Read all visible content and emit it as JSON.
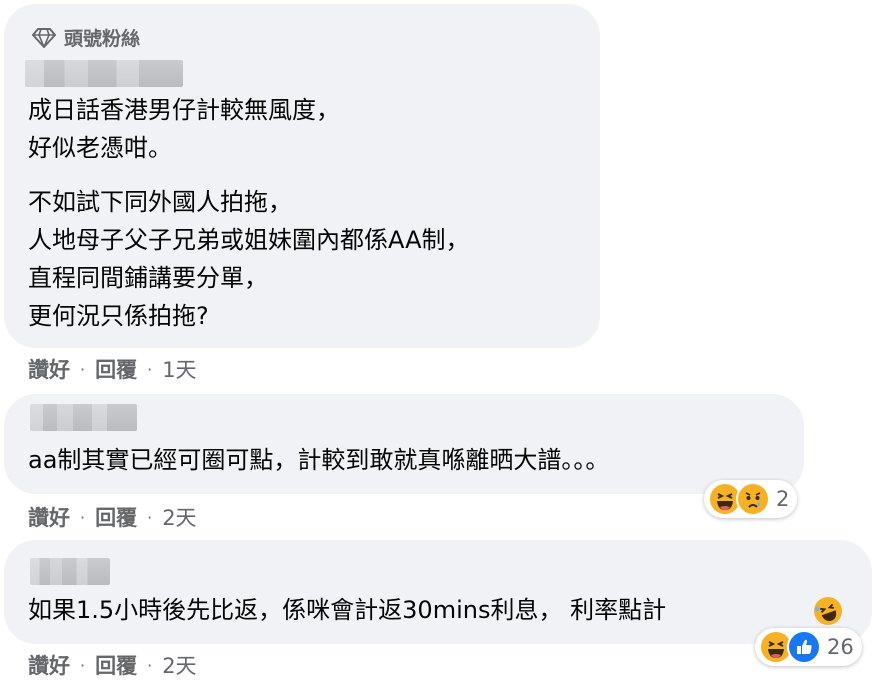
{
  "comments": [
    {
      "badge": "頭號粉絲",
      "lines_a": [
        "成日話香港男仔計較無風度，",
        "好似老憑咁。"
      ],
      "lines_b": [
        "不如試下同外國人拍拖，",
        "人地母子父子兄弟或姐妹圍內都係AA制，",
        "直程同間鋪講要分單，",
        "更何況只係拍拖?"
      ],
      "like_label": "讚好",
      "reply_label": "回覆",
      "time": "1天"
    },
    {
      "line": "aa制其實已經可圈可點，計較到敢就真喺離晒大譜。。。",
      "like_label": "讚好",
      "reply_label": "回覆",
      "time": "2天",
      "reactions": {
        "icons": [
          "haha-icon",
          "sad-icon"
        ],
        "count": "2"
      }
    },
    {
      "line": "如果1.5小時後先比返，係咪會計返30mins利息， 利率點計",
      "like_label": "讚好",
      "reply_label": "回覆",
      "time": "2天",
      "reactions": {
        "icons": [
          "haha-icon",
          "like-icon"
        ],
        "count": "26"
      }
    }
  ],
  "colors": {
    "bubble": "#f0f2f5",
    "meta": "#65676b",
    "like_blue": "#1877f2",
    "emoji_yellow": "#f7b125"
  },
  "separator": "·"
}
